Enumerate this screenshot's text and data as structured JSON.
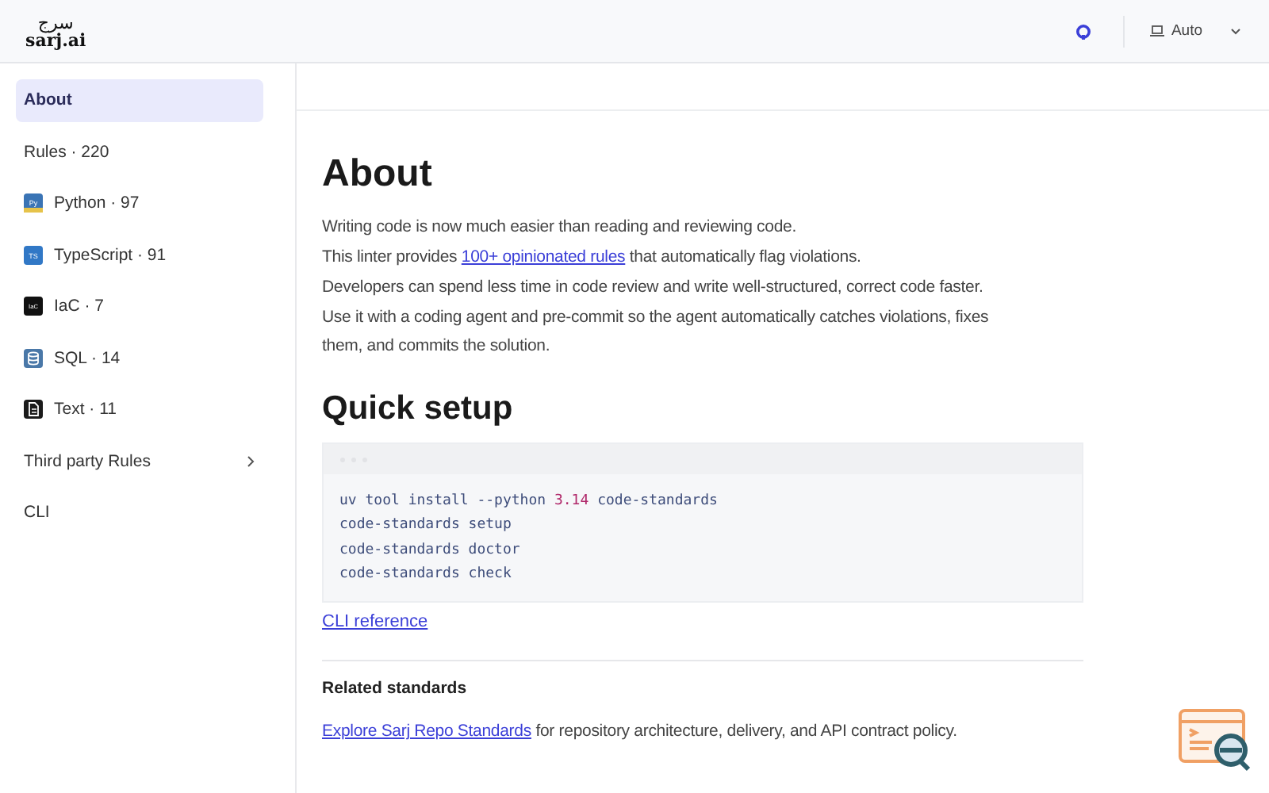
{
  "header": {
    "logo_arabic": "سرج",
    "logo_latin": "sarj.ai",
    "theme": "Auto"
  },
  "sidebar": {
    "items": [
      {
        "label": "About",
        "selected": true,
        "kind": "plain"
      },
      {
        "label": "Rules · 220",
        "selected": false,
        "kind": "plain"
      },
      {
        "label": "Python · 97",
        "selected": false,
        "kind": "python",
        "badge": "Py"
      },
      {
        "label": "TypeScript · 91",
        "selected": false,
        "kind": "typescript",
        "badge": "TS"
      },
      {
        "label": "IaC · 7",
        "selected": false,
        "kind": "iac",
        "badge": "IaC"
      },
      {
        "label": "SQL · 14",
        "selected": false,
        "kind": "sql"
      },
      {
        "label": "Text · 11",
        "selected": false,
        "kind": "text"
      },
      {
        "label": "Third party Rules",
        "selected": false,
        "kind": "group",
        "expanded": false
      },
      {
        "label": "CLI",
        "selected": false,
        "kind": "plain"
      }
    ]
  },
  "main": {
    "title": "About",
    "paragraphs": [
      [
        {
          "text": "Writing code is now much easier than reading and reviewing code."
        }
      ],
      [
        {
          "text": "This linter provides "
        },
        {
          "text": "100+ opinionated rules",
          "link": true
        },
        {
          "text": " that automatically flag violations."
        }
      ],
      [
        {
          "text": "Developers can spend less time in code review and write well-structured, correct code faster."
        }
      ],
      [
        {
          "text": "Use it with a coding agent and pre-commit so the agent automatically catches violations, fixes them, and commits the solution."
        }
      ]
    ],
    "setup_title": "Quick setup",
    "code_lines": [
      [
        {
          "text": "uv tool install --python "
        },
        {
          "text": "3.14",
          "kind": "number"
        },
        {
          "text": " code-standards"
        }
      ],
      [
        {
          "text": "code-standards setup"
        }
      ],
      [
        {
          "text": "code-standards doctor"
        }
      ],
      [
        {
          "text": "code-standards check"
        }
      ]
    ],
    "cli_link": "CLI reference",
    "related_title": "Related standards",
    "related": [
      {
        "text": "Explore Sarj Repo Standards",
        "link": true
      },
      {
        "text": " for repository architecture, delivery, and API contract policy."
      }
    ]
  }
}
